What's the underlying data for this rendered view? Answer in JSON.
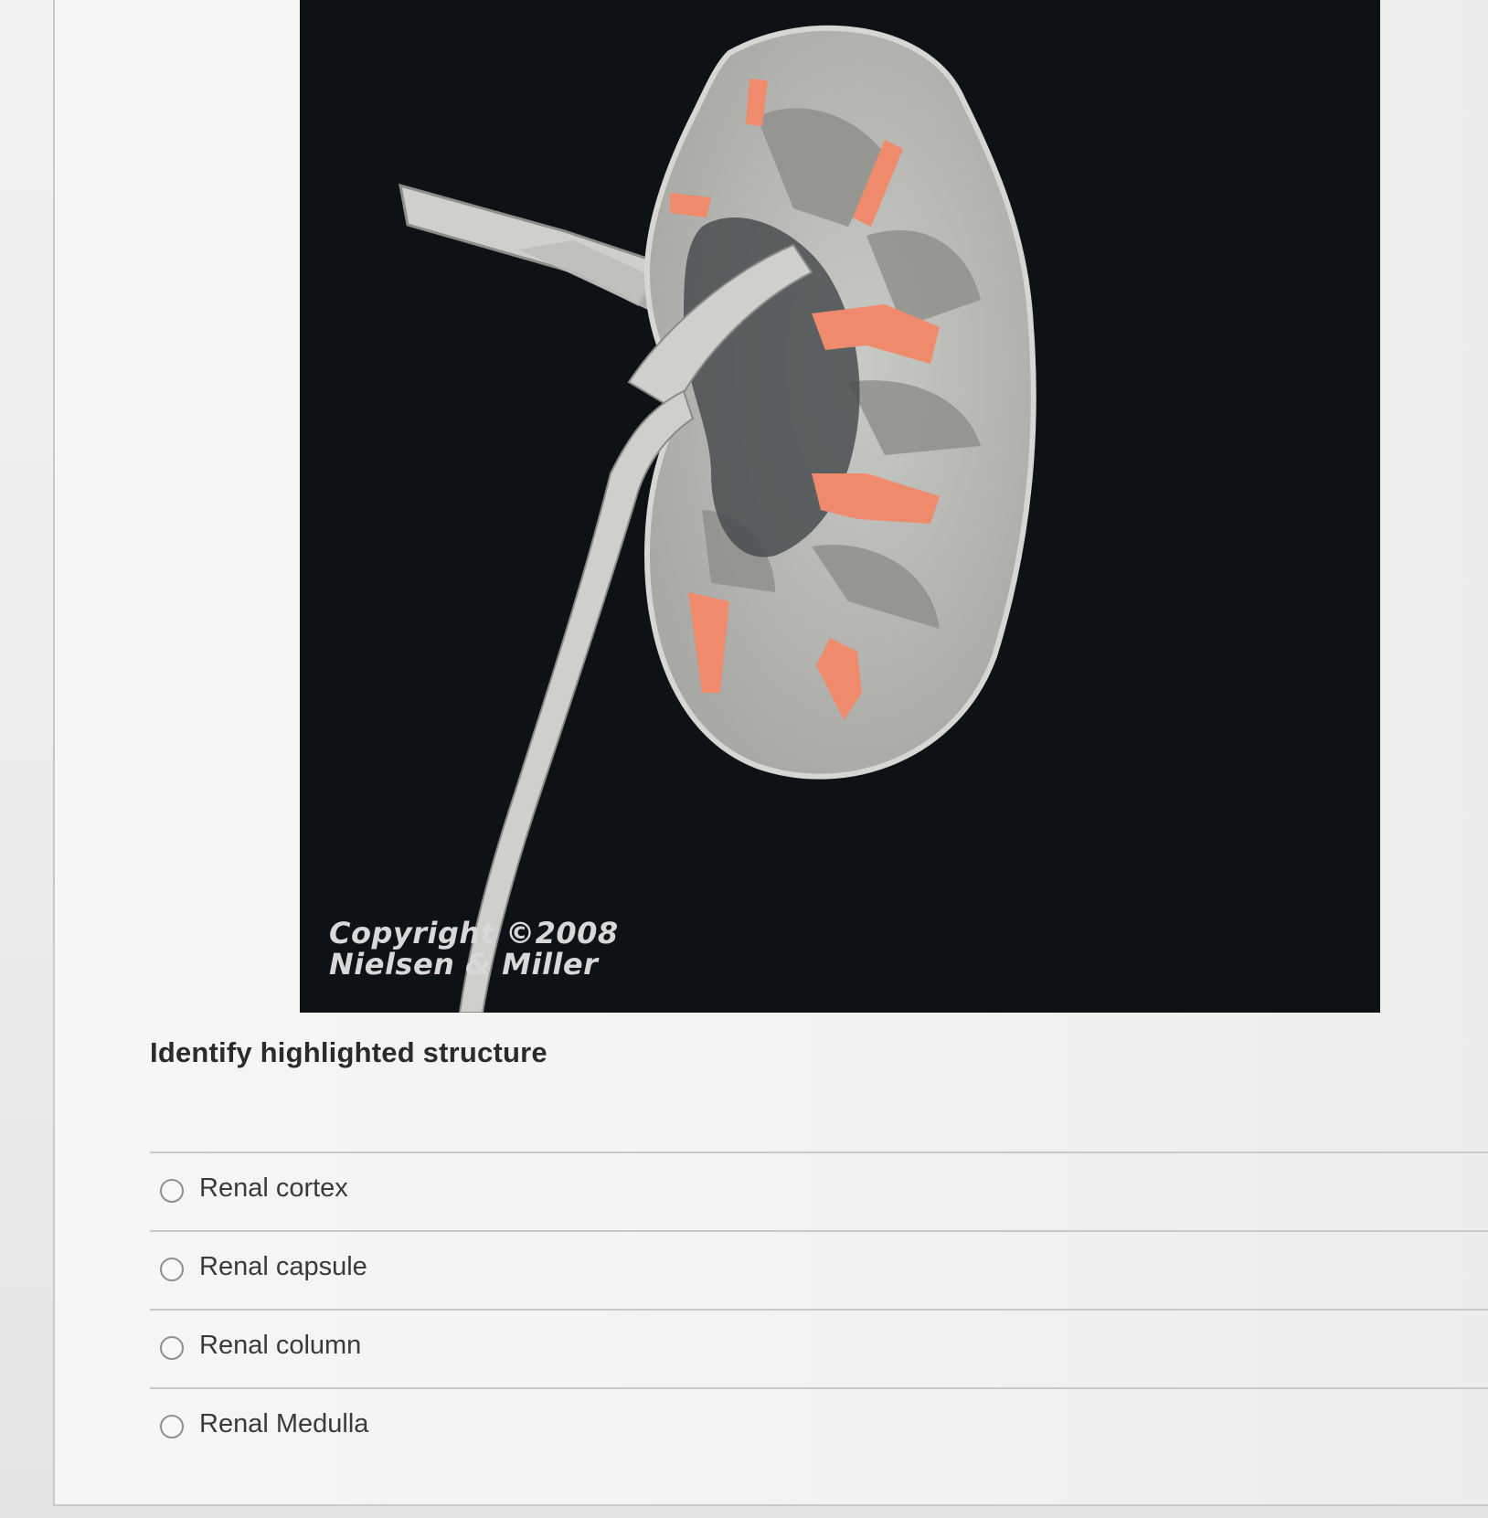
{
  "question": {
    "figure": {
      "copyright_line1": "Copyright ©2008",
      "copyright_line2": "Nielsen & Miller",
      "background_color": "#0d1216",
      "highlight_color": "#f08a6c"
    },
    "prompt": "Identify highlighted structure",
    "options": [
      {
        "label": "Renal cortex",
        "selected": false
      },
      {
        "label": "Renal capsule",
        "selected": false
      },
      {
        "label": "Renal column",
        "selected": false
      },
      {
        "label": "Renal Medulla",
        "selected": false
      }
    ]
  }
}
